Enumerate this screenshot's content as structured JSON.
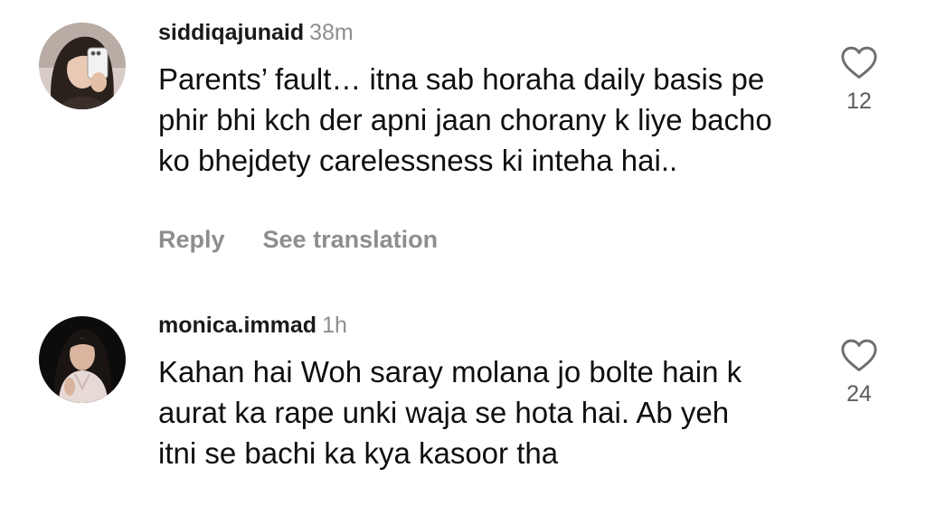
{
  "comments": [
    {
      "username": "siddiqajunaid",
      "time": "38m",
      "text": "Parents’ fault… itna sab horaha daily basis pe phir bhi kch der apni jaan chorany k liye bacho ko bhejdety carelessness ki inteha hai..",
      "reply_label": "Reply",
      "translation_label": "See translation",
      "like_count": "12",
      "like_icon": "heart-outline-icon"
    },
    {
      "username": "monica.immad",
      "time": "1h",
      "text": "Kahan hai Woh saray molana jo bolte hain k aurat ka rape unki waja se hota hai. Ab yeh itni se bachi ka kya kasoor tha",
      "like_count": "24",
      "like_icon": "heart-outline-icon"
    }
  ]
}
